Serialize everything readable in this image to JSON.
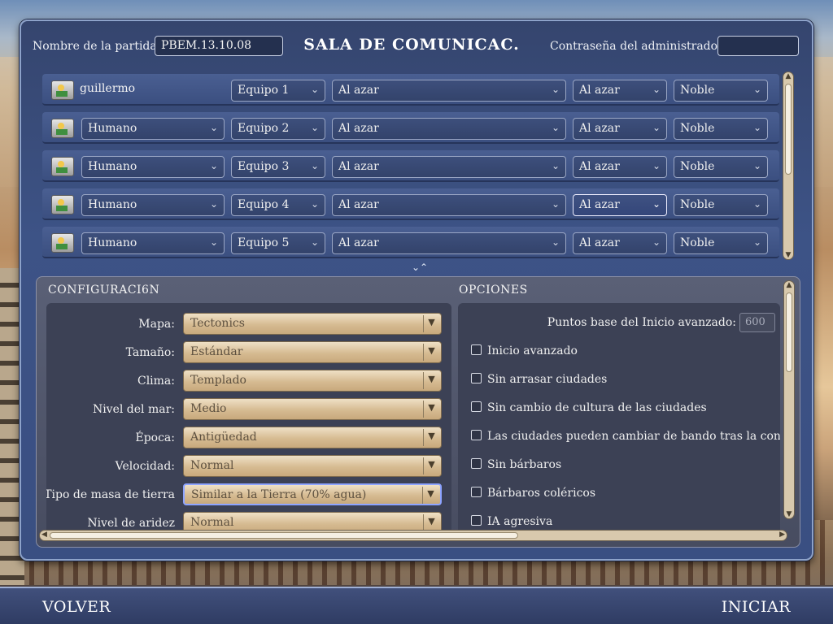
{
  "header": {
    "game_name_label": "Nombre de la partida",
    "game_name_value": "PBEM.13.10.08",
    "title": "SALA DE COMUNICAC.",
    "admin_password_label": "Contraseña del administrador:",
    "admin_password_value": ""
  },
  "players": [
    {
      "name": "guillermo",
      "team": "Equipo 1",
      "civ": "Al azar",
      "leader": "Al azar",
      "difficulty": "Noble"
    },
    {
      "name": "Humano",
      "team": "Equipo 2",
      "civ": "Al azar",
      "leader": "Al azar",
      "difficulty": "Noble"
    },
    {
      "name": "Humano",
      "team": "Equipo 3",
      "civ": "Al azar",
      "leader": "Al azar",
      "difficulty": "Noble"
    },
    {
      "name": "Humano",
      "team": "Equipo 4",
      "civ": "Al azar",
      "leader": "Al azar",
      "difficulty": "Noble"
    },
    {
      "name": "Humano",
      "team": "Equipo 5",
      "civ": "Al azar",
      "leader": "Al azar",
      "difficulty": "Noble"
    }
  ],
  "config": {
    "heading": "CONFIGURACI6N",
    "rows": [
      {
        "label": "Mapa:",
        "value": "Tectonics"
      },
      {
        "label": "Tamaño:",
        "value": "Estándar"
      },
      {
        "label": "Clima:",
        "value": "Templado"
      },
      {
        "label": "Nivel del mar:",
        "value": "Medio"
      },
      {
        "label": "Época:",
        "value": "Antigüedad"
      },
      {
        "label": "Velocidad:",
        "value": "Normal"
      },
      {
        "label": "Tipo de masa de tierra",
        "value": "Similar a la Tierra (70% agua)"
      },
      {
        "label": "Nivel de aridez",
        "value": "Normal"
      }
    ]
  },
  "options": {
    "heading": "OPCIONES",
    "advanced_start_points_label": "Puntos base del Inicio avanzado:",
    "advanced_start_points_value": "600",
    "items": [
      {
        "label": "Inicio avanzado",
        "checked": false
      },
      {
        "label": "Sin arrasar ciudades",
        "checked": false
      },
      {
        "label": "Sin cambio de cultura de las ciudades",
        "checked": false
      },
      {
        "label": "Las ciudades pueden cambiar de bando tras la conquista",
        "checked": false
      },
      {
        "label": "Sin bárbaros",
        "checked": false
      },
      {
        "label": "Bárbaros coléricos",
        "checked": false
      },
      {
        "label": "IA agresiva",
        "checked": false
      }
    ]
  },
  "footer": {
    "back_label": "VOLVER",
    "start_label": "INICIAR"
  },
  "colors": {
    "panel": "#3d5386",
    "dropdown_tan": "#d6bb92",
    "bottom_bar": "#2f3c63"
  }
}
